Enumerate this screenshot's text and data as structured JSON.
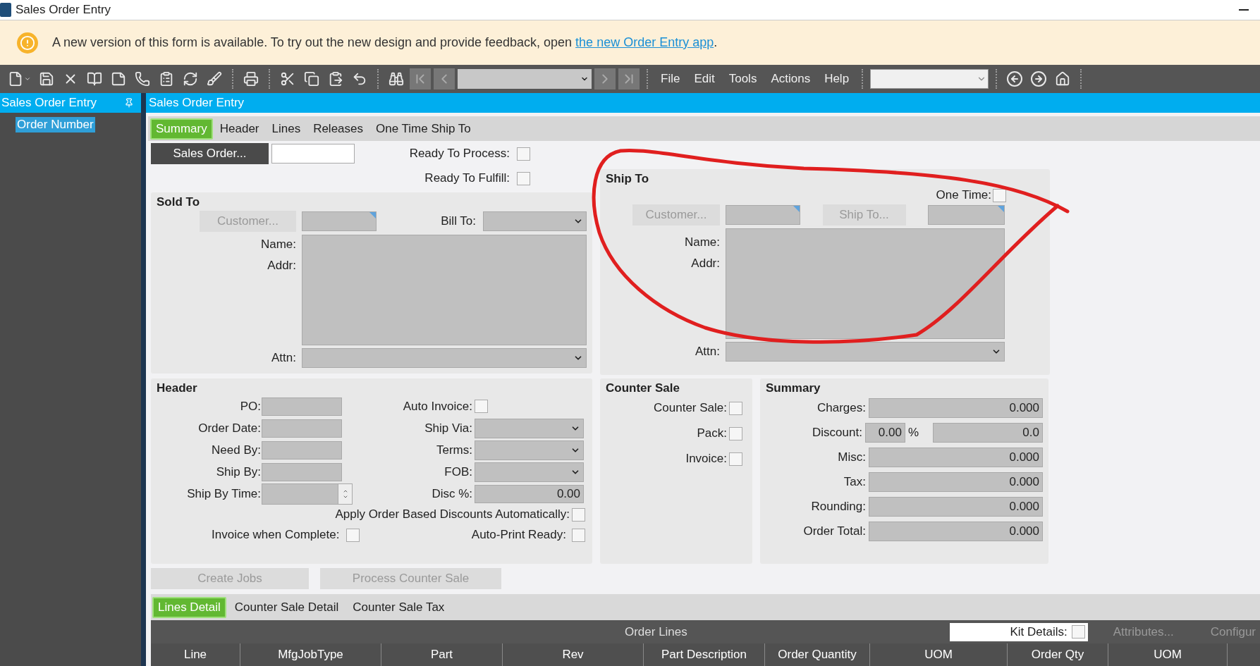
{
  "window": {
    "title": "Sales Order Entry"
  },
  "banner": {
    "text": "A new version of this form is available. To try out the new design and provide feedback, open ",
    "link": "the new Order Entry app",
    "after": "."
  },
  "toolbar": {
    "menus": [
      "File",
      "Edit",
      "Tools",
      "Actions",
      "Help"
    ]
  },
  "sidebar": {
    "title": "Sales Order Entry",
    "items": [
      {
        "label": "Order Number",
        "selected": true
      }
    ]
  },
  "panel": {
    "title": "Sales Order Entry"
  },
  "tabs": [
    {
      "label": "Summary",
      "selected": true
    },
    {
      "label": "Header",
      "selected": false
    },
    {
      "label": "Lines",
      "selected": false
    },
    {
      "label": "Releases",
      "selected": false
    },
    {
      "label": "One Time Ship To",
      "selected": false
    }
  ],
  "sales_order": {
    "label": "Sales Order...",
    "disabled": false
  },
  "ready": [
    {
      "label": "Ready To Process:",
      "checked": false
    },
    {
      "label": "Ready To Fulfill:",
      "checked": false
    }
  ],
  "sold_to": {
    "title": "Sold To",
    "customer_button": {
      "label": "Customer...",
      "disabled": true
    },
    "bill_to_label": "Bill To:",
    "name_label": "Name:",
    "addr_label": "Addr:",
    "attn_label": "Attn:"
  },
  "ship_to": {
    "title": "Ship To",
    "one_time": {
      "label": "One Time:",
      "checked": false
    },
    "customer_button": {
      "label": "Customer...",
      "disabled": true
    },
    "ship_to_button": {
      "label": "Ship To...",
      "disabled": true
    },
    "name_label": "Name:",
    "addr_label": "Addr:",
    "attn_label": "Attn:"
  },
  "header": {
    "title": "Header",
    "left_fields": [
      {
        "label": "PO:",
        "kind": "text"
      },
      {
        "label": "Order Date:",
        "kind": "text"
      },
      {
        "label": "Need By:",
        "kind": "text"
      },
      {
        "label": "Ship By:",
        "kind": "text"
      },
      {
        "label": "Ship By Time:",
        "kind": "spinner"
      }
    ],
    "right_fields": [
      {
        "label": "Auto Invoice:",
        "kind": "checkbox",
        "checked": false
      },
      {
        "label": "Ship Via:",
        "kind": "dropdown"
      },
      {
        "label": "Terms:",
        "kind": "dropdown"
      },
      {
        "label": "FOB:",
        "kind": "dropdown"
      },
      {
        "label": "Disc %:",
        "kind": "number",
        "value": "0.00"
      }
    ],
    "apply_discounts": {
      "label": "Apply Order Based Discounts Automatically:",
      "checked": false
    },
    "invoice_complete": {
      "label": "Invoice when Complete:",
      "checked": false
    },
    "auto_print": {
      "label": "Auto-Print Ready:",
      "checked": false
    }
  },
  "counter_sale": {
    "title": "Counter Sale",
    "options": [
      {
        "label": "Counter Sale:",
        "checked": false
      },
      {
        "label": "Pack:",
        "checked": false
      },
      {
        "label": "Invoice:",
        "checked": false
      }
    ]
  },
  "summary": {
    "title": "Summary",
    "rows": [
      {
        "label": "Charges:",
        "kind": "amount",
        "value": "0.000"
      },
      {
        "label": "Discount:",
        "kind": "discount",
        "percent": "0.00",
        "unit": "%",
        "value": "0.0"
      },
      {
        "label": "Misc:",
        "kind": "amount",
        "value": "0.000"
      },
      {
        "label": "Tax:",
        "kind": "amount",
        "value": "0.000"
      },
      {
        "label": "Rounding:",
        "kind": "amount",
        "value": "0.000"
      },
      {
        "label": "Order Total:",
        "kind": "amount",
        "value": "0.000"
      }
    ]
  },
  "actions": [
    {
      "label": "Create Jobs",
      "disabled": true
    },
    {
      "label": "Process Counter Sale",
      "disabled": true
    }
  ],
  "detail_tabs": [
    {
      "label": "Lines Detail",
      "selected": true
    },
    {
      "label": "Counter Sale Detail",
      "selected": false
    },
    {
      "label": "Counter Sale Tax",
      "selected": false
    }
  ],
  "grid": {
    "title": "Order Lines",
    "kit_details": {
      "label": "Kit Details:",
      "checked": false
    },
    "buttons": [
      {
        "label": "Attributes...",
        "disabled": true
      },
      {
        "label": "Configur",
        "disabled": true
      }
    ],
    "columns": [
      "Line",
      "MfgJobType",
      "Part",
      "Rev",
      "Part Description",
      "Order Quantity",
      "UOM",
      "Order Qty",
      "UOM"
    ]
  }
}
